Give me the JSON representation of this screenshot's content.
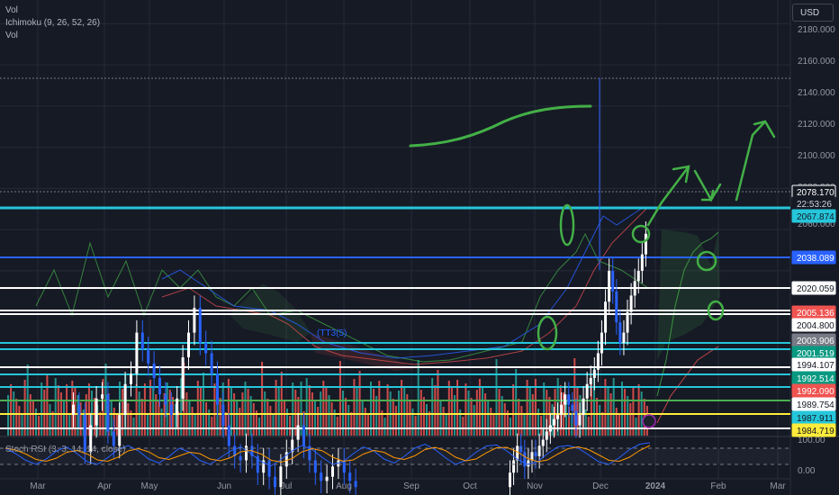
{
  "legend": {
    "line1": "Vol",
    "line2": "Ichimoku (9, 26, 52, 26)",
    "line3": "Vol",
    "stoch": "Stoch RSI (3, 3, 14, 14, close)"
  },
  "currency_button": "USD",
  "ichimoku_label": "(TT3(5)",
  "colors": {
    "background": "#161a25",
    "grid": "#262b38",
    "up_candle": "#ffffff",
    "down_candle": "#2962ff",
    "cyan_line": "#26c6da",
    "blue_line": "#2962ff",
    "white_line": "#ffffff",
    "green_line": "#4caf50",
    "yellow_line": "#ffeb3b",
    "vol_up": "#26a69a",
    "vol_down": "#ef5350",
    "drawing": "#43b047",
    "stoch_k": "#2962ff",
    "stoch_d": "#ff9800"
  },
  "price_scale": {
    "ticks": [
      "2180.000",
      "2160.000",
      "2140.000",
      "2120.000",
      "2100.000",
      "2080.000",
      "2060.000"
    ],
    "labels": [
      {
        "text": "2078.170",
        "bg": "#161a25",
        "fg": "#ffffff",
        "border": "#ffffff"
      },
      {
        "text": "22:53:26",
        "bg": "#161a25",
        "fg": "#d1d4dc",
        "border": "#161a25"
      },
      {
        "text": "2067.874",
        "bg": "#26c6da",
        "fg": "#131722",
        "border": "#26c6da"
      },
      {
        "text": "2038.089",
        "bg": "#2962ff",
        "fg": "#ffffff",
        "border": "#2962ff"
      },
      {
        "text": "2020.059",
        "bg": "#ffffff",
        "fg": "#131722",
        "border": "#ffffff"
      },
      {
        "text": "2005.136",
        "bg": "#ef5350",
        "fg": "#ffffff",
        "border": "#ef5350"
      },
      {
        "text": "2004.800",
        "bg": "#ffffff",
        "fg": "#131722",
        "border": "#ffffff"
      },
      {
        "text": "2003.906",
        "bg": "#787b86",
        "fg": "#ffffff",
        "border": "#787b86"
      },
      {
        "text": "2001.519",
        "bg": "#089981",
        "fg": "#ffffff",
        "border": "#089981"
      },
      {
        "text": "1994.107",
        "bg": "#ffffff",
        "fg": "#131722",
        "border": "#ffffff"
      },
      {
        "text": "1992.514",
        "bg": "#089981",
        "fg": "#ffffff",
        "border": "#089981"
      },
      {
        "text": "1992.090",
        "bg": "#ef5350",
        "fg": "#ffffff",
        "border": "#ef5350"
      },
      {
        "text": "1989.754",
        "bg": "#ffffff",
        "fg": "#131722",
        "border": "#ffffff"
      },
      {
        "text": "1987.911",
        "bg": "#26c6da",
        "fg": "#131722",
        "border": "#26c6da"
      },
      {
        "text": "1984.719",
        "bg": "#ffeb3b",
        "fg": "#131722",
        "border": "#ffeb3b"
      }
    ],
    "stoch_ticks": [
      "100.00",
      "0.00"
    ]
  },
  "chart_data": {
    "type": "candlestick",
    "symbol_currency": "USD",
    "x_ticks": [
      "Mar",
      "Apr",
      "May",
      "Jun",
      "Jul",
      "Aug",
      "Sep",
      "Oct",
      "Nov",
      "Dec",
      "2024",
      "Feb",
      "Mar"
    ],
    "y_ticks": [
      2180,
      2160,
      2140,
      2120,
      2100,
      2080,
      2060
    ],
    "last_price": 2078.17,
    "countdown": "22:53:26",
    "horizontal_levels": [
      {
        "price": 2067.874,
        "color": "cyan"
      },
      {
        "price": 2038.089,
        "color": "blue"
      },
      {
        "price": 2020.059,
        "color": "white"
      },
      {
        "price": 2005.136,
        "color": "white"
      },
      {
        "price": 2004.8,
        "color": "white"
      },
      {
        "price": 2003.906,
        "color": "cyan"
      },
      {
        "price": 2001.519,
        "color": "cyan"
      },
      {
        "price": 1994.107,
        "color": "white"
      },
      {
        "price": 1992.514,
        "color": "cyan"
      },
      {
        "price": 1992.09,
        "color": "cyan"
      },
      {
        "price": 1989.754,
        "color": "green"
      },
      {
        "price": 1987.911,
        "color": "yellow"
      },
      {
        "price": 1984.719,
        "color": "white"
      }
    ],
    "candles_approx_close": [
      1995,
      1990,
      1972,
      1985,
      1998,
      2000,
      1982,
      1975,
      1990,
      2005,
      2010,
      2030,
      2022,
      2015,
      2008,
      2000,
      1995,
      1990,
      1998,
      2018,
      2030,
      2042,
      2025,
      2020,
      2010,
      1995,
      1985,
      1975,
      1970,
      1968,
      1975,
      1970,
      1962,
      1968,
      1960,
      1955,
      1965,
      1972,
      1978,
      1985,
      1975,
      1968,
      1962,
      1958,
      1960,
      1965,
      1968,
      1962,
      1958,
      1955,
      1962,
      1968,
      1975,
      1972,
      1965,
      1968,
      1972,
      1970,
      1975,
      1978,
      1982,
      1985,
      1988,
      1990,
      1995,
      2000,
      1995,
      1992,
      1985,
      1990,
      1998,
      2005,
      2008,
      2012,
      2020,
      2030,
      2045,
      2060,
      2050,
      2035,
      2025,
      2030,
      2040,
      2048,
      2055,
      2060,
      2068,
      2078
    ],
    "stoch_rsi": {
      "k": [
        80,
        60,
        35,
        20,
        40,
        70,
        85,
        60,
        30,
        20,
        45,
        75,
        90,
        70,
        40,
        25,
        50,
        80,
        65,
        35,
        20,
        45,
        70,
        85,
        60,
        30,
        15,
        40,
        70,
        90,
        75,
        45,
        20,
        30,
        60,
        85,
        70,
        40,
        25,
        50,
        80,
        95,
        75,
        45,
        20,
        35,
        65,
        88,
        92,
        70,
        40,
        20,
        30,
        60,
        85,
        90,
        80,
        55,
        30,
        20,
        45,
        75,
        95,
        100
      ],
      "ylim": [
        0,
        100
      ]
    }
  },
  "annotations": [
    "green-trend-curve",
    "green-arrow-up",
    "green-arrow-down",
    "green-arrow-up-2",
    "green-circle-1",
    "green-circle-2",
    "green-circle-3"
  ]
}
